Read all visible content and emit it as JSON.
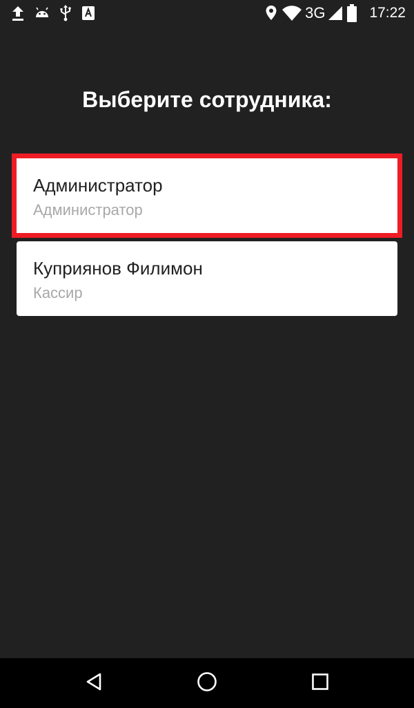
{
  "status_bar": {
    "left_icons": [
      "upload-icon",
      "android-icon",
      "usb-icon",
      "keyboard-a-icon"
    ],
    "right_icons": [
      "location-icon",
      "wifi-icon",
      "cell-signal-icon",
      "battery-icon"
    ],
    "network_type": "3G",
    "time": "17:22"
  },
  "page": {
    "title": "Выберите сотрудника:"
  },
  "employees": [
    {
      "name": "Администратор",
      "role": "Администратор",
      "selected": true
    },
    {
      "name": "Куприянов Филимон",
      "role": "Кассир",
      "selected": false
    }
  ],
  "nav_bar": {
    "buttons": [
      "back-icon",
      "home-icon",
      "recents-icon"
    ]
  },
  "colors": {
    "background": "#212121",
    "card": "#ffffff",
    "highlight": "#ee1c24",
    "name_text": "#212121",
    "role_text": "#a8a8a8"
  }
}
